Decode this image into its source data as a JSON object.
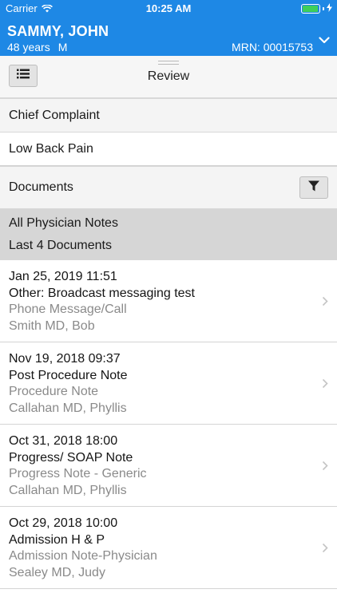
{
  "status_bar": {
    "carrier": "Carrier",
    "time": "10:25 AM",
    "battery_level": 0.95,
    "battery_color": "#3ecf5a"
  },
  "patient": {
    "name": "SAMMY, JOHN",
    "age": "48 years",
    "sex": "M",
    "mrn": "MRN: 00015753"
  },
  "toolbar": {
    "title": "Review",
    "list_icon": "list-icon"
  },
  "chief_complaint": {
    "label": "Chief Complaint",
    "value": "Low Back Pain"
  },
  "documents": {
    "label": "Documents",
    "filter_icon": "filter-icon",
    "group": "All Physician Notes",
    "subgroup": "Last 4 Documents",
    "items": [
      {
        "date": "Jan 25, 2019 11:51",
        "title": "Other: Broadcast messaging test",
        "type": "Phone Message/Call",
        "author": "Smith MD, Bob"
      },
      {
        "date": "Nov 19, 2018 09:37",
        "title": "Post Procedure Note",
        "type": "Procedure Note",
        "author": "Callahan MD, Phyllis"
      },
      {
        "date": "Oct 31, 2018 18:00",
        "title": "Progress/ SOAP Note",
        "type": "Progress Note - Generic",
        "author": "Callahan MD, Phyllis"
      },
      {
        "date": "Oct 29, 2018 10:00",
        "title": "Admission H & P",
        "type": "Admission Note-Physician",
        "author": "Sealey MD, Judy"
      }
    ]
  },
  "colors": {
    "header_blue": "#1e88e5",
    "band_gray": "#d6d6d6",
    "secondary_text": "#8a8a8a"
  }
}
